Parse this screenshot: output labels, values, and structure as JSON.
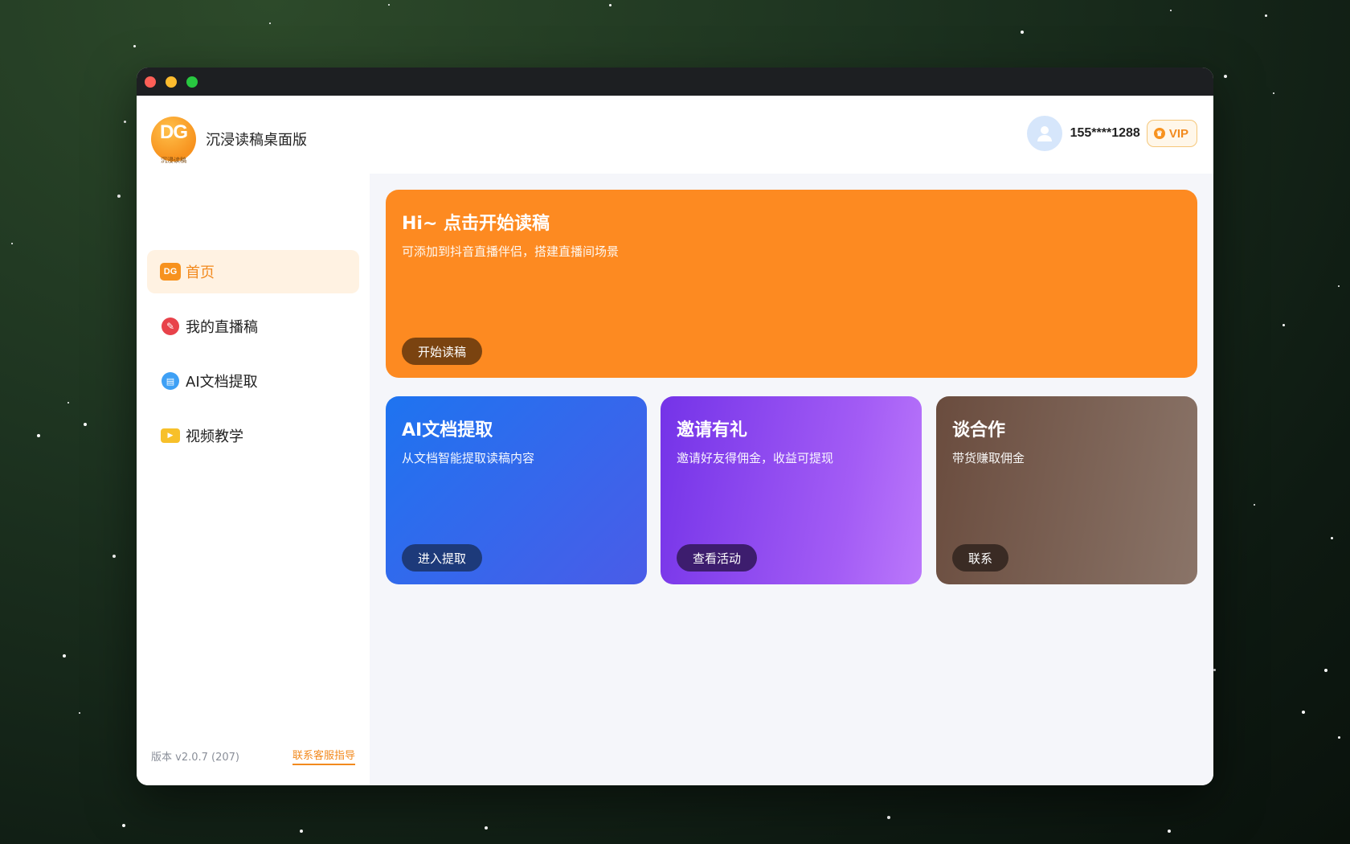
{
  "app": {
    "brand_name": "沉浸读稿桌面版",
    "logo_text": "DG",
    "logo_subtext": "沉浸读稿",
    "home_icon_text": "DG"
  },
  "sidebar": {
    "items": [
      {
        "label": "首页",
        "icon": "dg-logo-icon",
        "active": true
      },
      {
        "label": "我的直播稿",
        "icon": "live-script-icon",
        "active": false
      },
      {
        "label": "AI文档提取",
        "icon": "document-icon",
        "active": false
      },
      {
        "label": "视频教学",
        "icon": "video-icon",
        "active": false
      }
    ],
    "version": "版本 v2.0.7 (207)",
    "support_link": "联系客服指导"
  },
  "header": {
    "phone": "155****1288",
    "vip_label": "VIP",
    "avatar_icon": "user-icon"
  },
  "main": {
    "hero": {
      "title": "Hi~ 点击开始读稿",
      "subtitle": "可添加到抖音直播伴侣，搭建直播间场景",
      "button": "开始读稿",
      "color": "#fd8a21"
    },
    "cards": [
      {
        "title": "AI文档提取",
        "subtitle": "从文档智能提取读稿内容",
        "button": "进入提取",
        "color": "#1e74f0"
      },
      {
        "title": "邀请有礼",
        "subtitle": "邀请好友得佣金，收益可提现",
        "button": "查看活动",
        "color": "#7433e8"
      },
      {
        "title": "谈合作",
        "subtitle": "带货赚取佣金",
        "button": "联系",
        "color": "#6a4c3e"
      }
    ]
  },
  "colors": {
    "accent": "#f28a1e",
    "active_bg": "#fff2e2",
    "content_bg": "#f5f6fa"
  }
}
